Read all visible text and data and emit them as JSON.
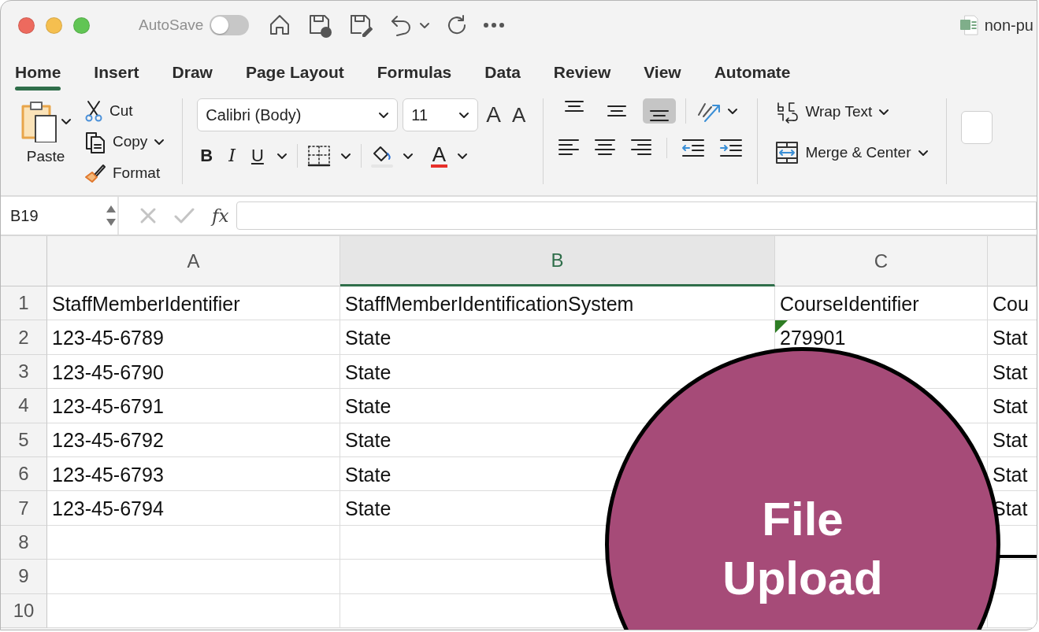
{
  "window": {
    "title": "non-pu"
  },
  "quick_access": {
    "autosave_label": "AutoSave",
    "autosave_on": false
  },
  "tabs": [
    {
      "label": "Home",
      "selected": true
    },
    {
      "label": "Insert",
      "selected": false
    },
    {
      "label": "Draw",
      "selected": false
    },
    {
      "label": "Page Layout",
      "selected": false
    },
    {
      "label": "Formulas",
      "selected": false
    },
    {
      "label": "Data",
      "selected": false
    },
    {
      "label": "Review",
      "selected": false
    },
    {
      "label": "View",
      "selected": false
    },
    {
      "label": "Automate",
      "selected": false
    }
  ],
  "ribbon": {
    "clipboard": {
      "paste": "Paste",
      "cut": "Cut",
      "copy": "Copy",
      "format": "Format"
    },
    "font": {
      "font_name": "Calibri (Body)",
      "font_size": "11",
      "grow_glyph": "A",
      "shrink_glyph": "A",
      "color_glyph": "A",
      "styles": [
        {
          "kind": "bold",
          "glyph": "B"
        },
        {
          "kind": "italic",
          "glyph": "I"
        },
        {
          "kind": "underline",
          "glyph": "U"
        }
      ]
    },
    "vertical_align": [
      {
        "kind": "top",
        "selected": false
      },
      {
        "kind": "middle",
        "selected": false
      },
      {
        "kind": "bottom",
        "selected": true
      }
    ],
    "wrap_text": "Wrap Text",
    "merge_center": "Merge & Center"
  },
  "formula_bar": {
    "name_box": "B19",
    "fx": "fx"
  },
  "sheet": {
    "columns": [
      {
        "label": "A",
        "selected": false
      },
      {
        "label": "B",
        "selected": true
      },
      {
        "label": "C",
        "selected": false
      }
    ],
    "rows": [
      {
        "number": "1",
        "flagged": false,
        "cells": [
          "StaffMemberIdentifier",
          "StaffMemberIdentificationSystem",
          "CourseIdentifier",
          "Cou"
        ]
      },
      {
        "number": "2",
        "flagged": true,
        "cells": [
          "123-45-6789",
          "State",
          "279901",
          "Stat"
        ]
      },
      {
        "number": "3",
        "flagged": false,
        "cells": [
          "123-45-6790",
          "State",
          null,
          "Stat"
        ]
      },
      {
        "number": "4",
        "flagged": false,
        "cells": [
          "123-45-6791",
          "State",
          null,
          "Stat"
        ]
      },
      {
        "number": "5",
        "flagged": false,
        "cells": [
          "123-45-6792",
          "State",
          null,
          "Stat"
        ]
      },
      {
        "number": "6",
        "flagged": false,
        "cells": [
          "123-45-6793",
          "State",
          null,
          "Stat"
        ]
      },
      {
        "number": "7",
        "flagged": false,
        "cells": [
          "123-45-6794",
          "State",
          null,
          "Stat"
        ]
      },
      {
        "number": "8",
        "flagged": false
      },
      {
        "number": "9",
        "flagged": false
      },
      {
        "number": "10",
        "flagged": false
      }
    ]
  },
  "callout": {
    "text": "File Upload"
  }
}
